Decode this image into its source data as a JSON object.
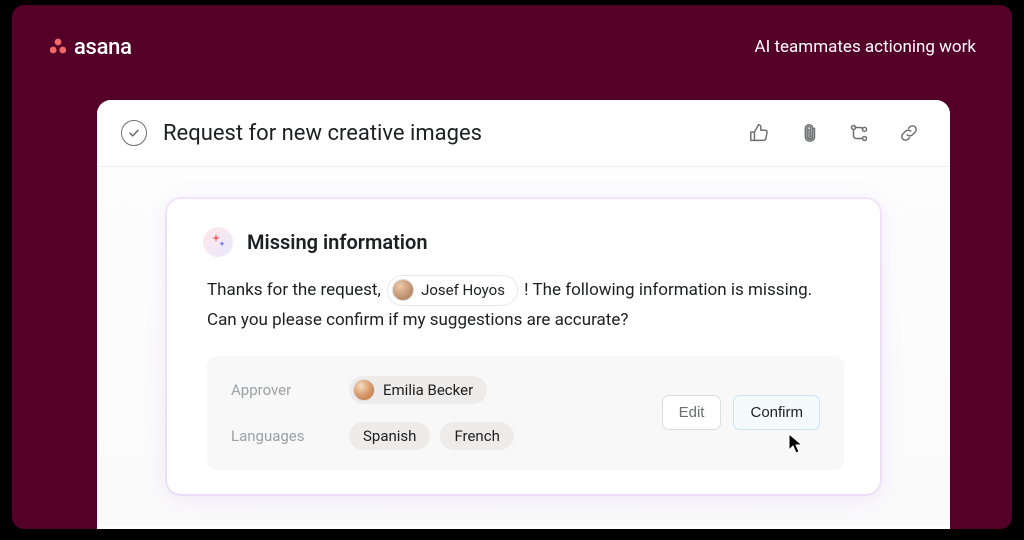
{
  "brand": {
    "name": "asana"
  },
  "header": {
    "tagline": "AI teammates actioning work"
  },
  "task": {
    "title": "Request for new creative images"
  },
  "ai_card": {
    "title": "Missing information",
    "greeting_pre": "Thanks for the request, ",
    "mention_name": "Josef Hoyos",
    "greeting_post": " ! The following information is missing. Can you please confirm if my suggestions are accurate?",
    "fields": {
      "approver_label": "Approver",
      "approver_name": "Emilia Becker",
      "languages_label": "Languages",
      "language_1": "Spanish",
      "language_2": "French"
    },
    "actions": {
      "edit": "Edit",
      "confirm": "Confirm"
    }
  }
}
